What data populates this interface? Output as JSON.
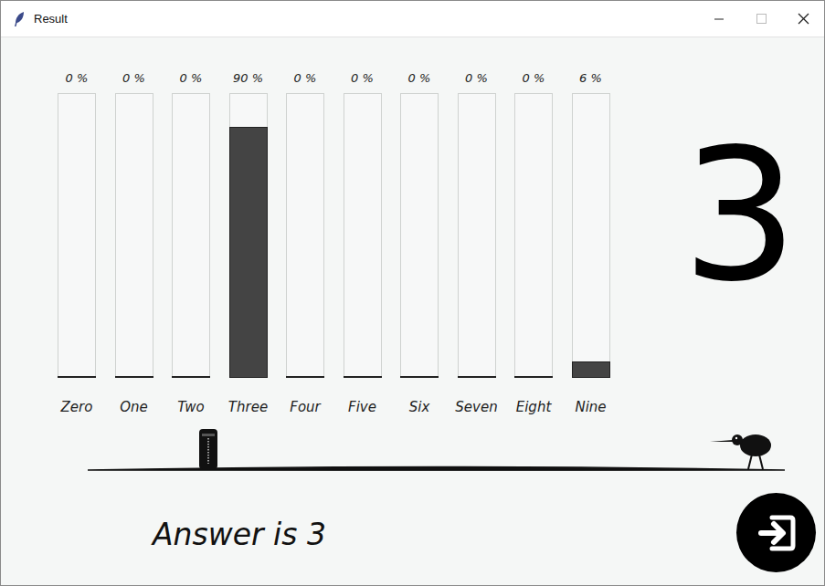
{
  "window": {
    "title": "Result"
  },
  "bars": [
    {
      "label": "Zero",
      "percent": "0 %",
      "level": 0
    },
    {
      "label": "One",
      "percent": "0 %",
      "level": 0
    },
    {
      "label": "Two",
      "percent": "0 %",
      "level": 0
    },
    {
      "label": "Three",
      "percent": "90 %",
      "level": 0.88
    },
    {
      "label": "Four",
      "percent": "0 %",
      "level": 0
    },
    {
      "label": "Five",
      "percent": "0 %",
      "level": 0
    },
    {
      "label": "Six",
      "percent": "0 %",
      "level": 0
    },
    {
      "label": "Seven",
      "percent": "0 %",
      "level": 0
    },
    {
      "label": "Eight",
      "percent": "0 %",
      "level": 0
    },
    {
      "label": "Nine",
      "percent": "6 %",
      "level": 0.05
    }
  ],
  "prediction": "3",
  "answer": "Answer is 3"
}
